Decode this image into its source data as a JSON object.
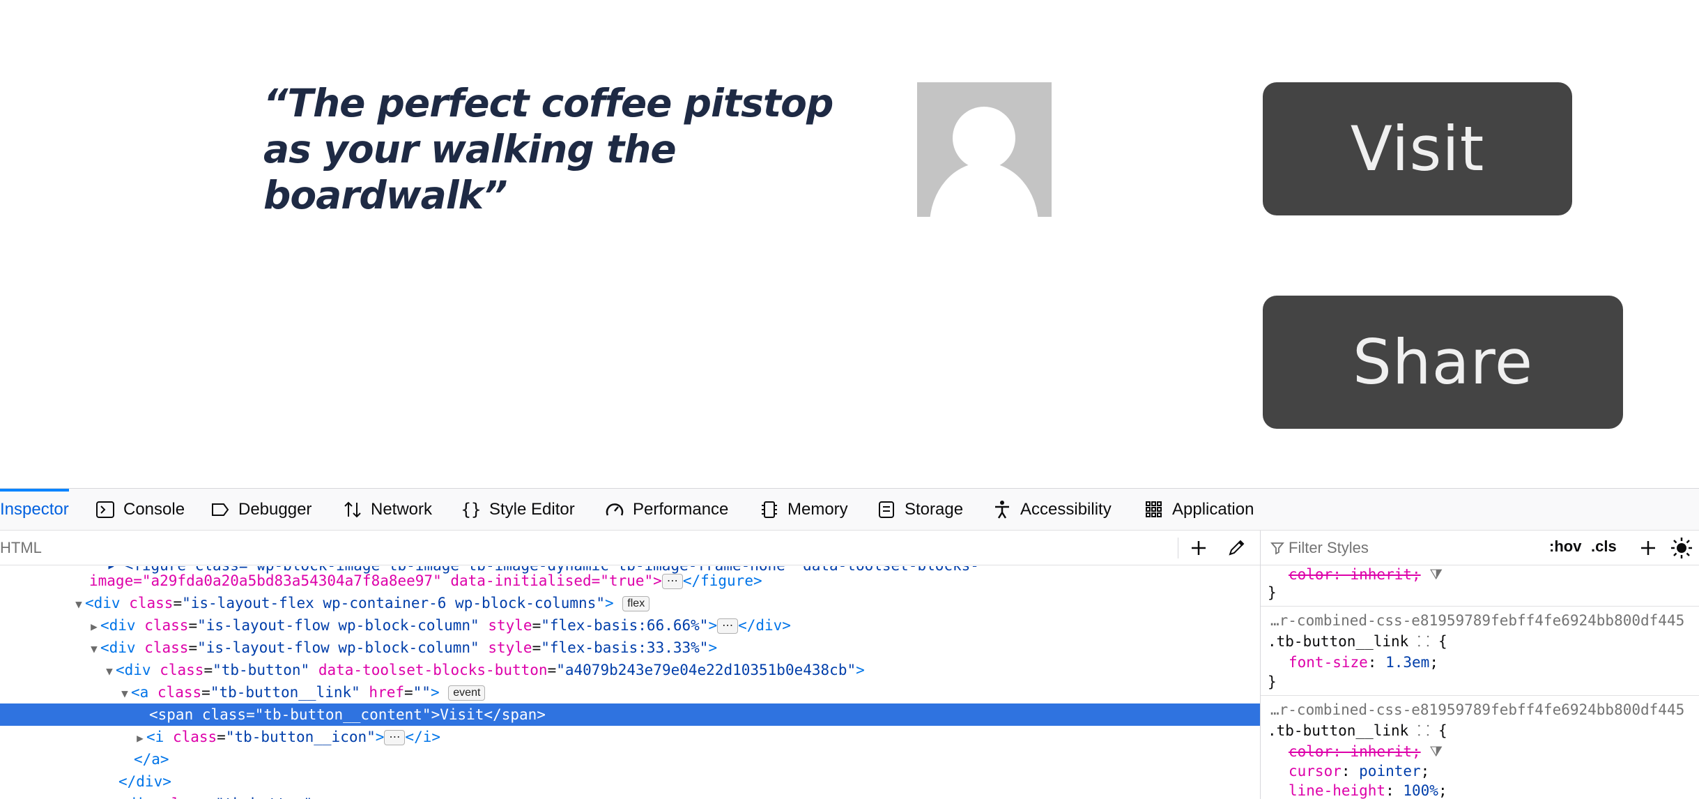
{
  "page": {
    "quote": "“The perfect coffee pitstop as your walking the boardwalk”",
    "visit_label": "Visit",
    "share_label": "Share"
  },
  "devtools": {
    "tabs": [
      {
        "label": "Inspector",
        "icon": "inspector-icon"
      },
      {
        "label": "Console",
        "icon": "console-icon"
      },
      {
        "label": "Debugger",
        "icon": "debugger-icon"
      },
      {
        "label": "Network",
        "icon": "network-icon"
      },
      {
        "label": "Style Editor",
        "icon": "style-editor-icon"
      },
      {
        "label": "Performance",
        "icon": "performance-icon"
      },
      {
        "label": "Memory",
        "icon": "memory-icon"
      },
      {
        "label": "Storage",
        "icon": "storage-icon"
      },
      {
        "label": "Accessibility",
        "icon": "accessibility-icon"
      },
      {
        "label": "Application",
        "icon": "application-icon"
      }
    ],
    "search_placeholder": "HTML",
    "filter_placeholder": "Filter Styles",
    "hov_label": ":hov",
    "cls_label": ".cls",
    "markup": {
      "l0": "image=\"a29fda0a20a5bd83a54304a7f8a8ee97\" data-initialised=\"true\">",
      "l1_tag": "<div",
      "l1_attr": "class",
      "l1_val": "\"is-layout-flex wp-container-6 wp-block-columns\"",
      "l1_badge": "flex",
      "l2_val": "\"is-layout-flow wp-block-column\"",
      "l2_style": "\"flex-basis:66.66%\"",
      "l3_style": "\"flex-basis:33.33%\"",
      "l4_class": "\"tb-button\"",
      "l4_attr2": "data-toolset-blocks-button",
      "l4_val2": "\"a4079b243e79e04e22d10351b0e438cb\"",
      "l5_class": "\"tb-button__link\"",
      "l5_href": "\"\"",
      "l5_badge": "event",
      "l6": "<span class=\"tb-button__content\">Visit</span>",
      "l7_class": "\"tb-button__icon\"",
      "l8": "</a>",
      "l9": "</div>",
      "fig_close": "</figure>",
      "div_close": "</div>",
      "i_close": "</i>"
    },
    "rules": {
      "top_strike": "color: inherit;",
      "source1": "…r-combined-css-e81959789febff4fe6924bb800df445",
      "selector1": ".tb-button__link",
      "prop1": "font-size",
      "val1": "1.3em",
      "source2": "…r-combined-css-e81959789febff4fe6924bb800df445",
      "selector2": ".tb-button__link",
      "prop2a": "color: inherit;",
      "prop2b": "cursor",
      "val2b": "pointer",
      "prop2c": "line-height",
      "val2c": "100%"
    }
  }
}
